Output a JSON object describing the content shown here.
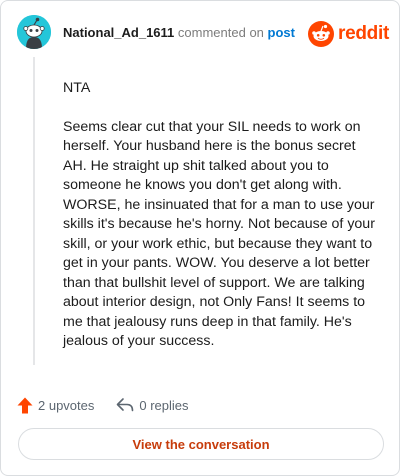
{
  "header": {
    "username": "National_Ad_1611",
    "action_text": "commented on",
    "post_link": "post"
  },
  "logo": {
    "word": "reddit",
    "icon": "reddit-alien-icon",
    "color": "#ff4500"
  },
  "avatar": {
    "icon": "snoo-avatar-icon",
    "color": "#24c6d9"
  },
  "comment": {
    "paragraphs": [
      "NTA",
      "Seems clear cut that your SIL needs to work on herself. Your husband here is the bonus secret AH. He straight up shit talked about you to someone he knows you don't get along with. WORSE, he insinuated that for a man to use your skills it's because he's horny. Not because of your skill, or your work ethic, but because they want to get in your pants. WOW. You deserve a lot better than that bullshit level of support. We are talking about interior design, not Only Fans! It seems to me that jealousy runs deep in that family. He's jealous of your success."
    ]
  },
  "actions": {
    "upvotes": "2 upvotes",
    "upvote_icon": "upvote-arrow-icon",
    "upvote_color": "#ff4500",
    "replies": "0 replies",
    "reply_icon": "reply-arrow-icon"
  },
  "button": {
    "label": "View the conversation",
    "color": "#c73c0b"
  }
}
